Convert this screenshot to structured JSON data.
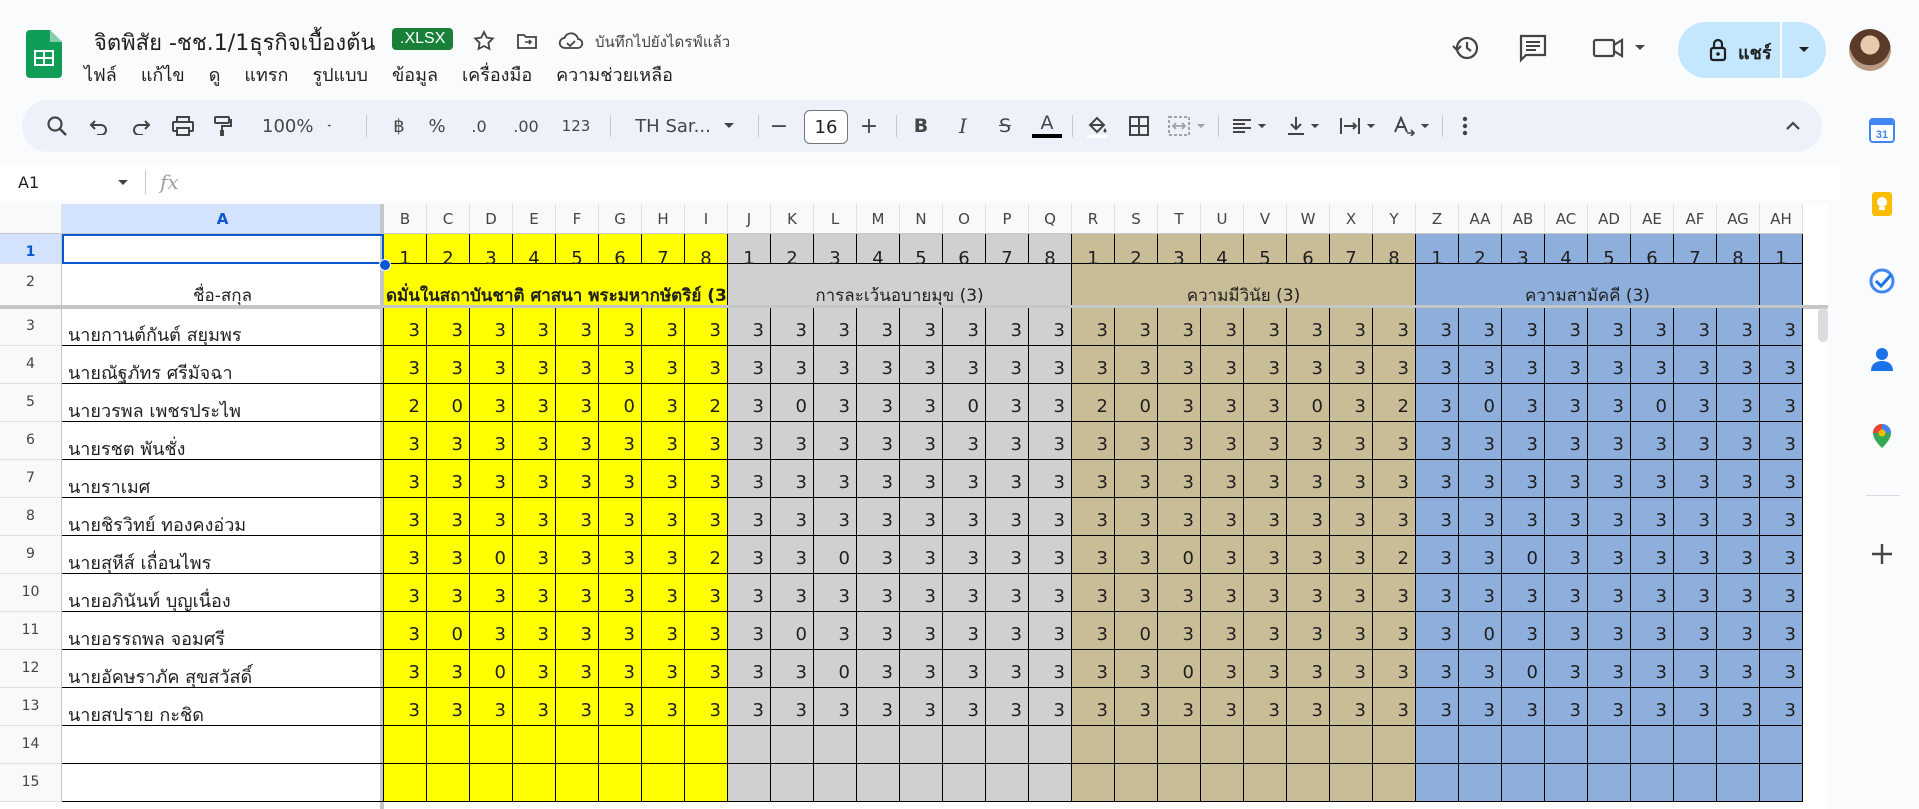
{
  "doc": {
    "title": "จิตพิสัย -ชช.1/1ธุรกิจเบื้องต้น",
    "badge": ".XLSX",
    "saved_status": "บันทึกไปยังไดรฟ์แล้ว"
  },
  "menu": [
    "ไฟล์",
    "แก้ไข",
    "ดู",
    "แทรก",
    "รูปแบบ",
    "ข้อมูล",
    "เครื่องมือ",
    "ความช่วยเหลือ"
  ],
  "share": {
    "label": "แชร์"
  },
  "toolbar": {
    "zoom": "100%",
    "currency": "฿",
    "percent": "%",
    "dec_decrease": ".0",
    "dec_increase": ".00",
    "number_format": "123",
    "font": "TH Sar...",
    "font_size": "16",
    "minus": "−",
    "plus": "+",
    "bold": "B",
    "italic": "I",
    "strike": "S",
    "text_color": "A"
  },
  "formula": {
    "cell_ref": "A1",
    "fx": "fx",
    "value": ""
  },
  "colors": {
    "yellow": "#ffff00",
    "gray": "#d0d0d0",
    "khaki": "#c8bd97",
    "blue": "#8eaedc",
    "accent": "#0b57d0",
    "sheets_green": "#0f9d58"
  },
  "columns": [
    "A",
    "B",
    "C",
    "D",
    "E",
    "F",
    "G",
    "H",
    "I",
    "J",
    "K",
    "L",
    "M",
    "N",
    "O",
    "P",
    "Q",
    "R",
    "S",
    "T",
    "U",
    "V",
    "W",
    "X",
    "Y",
    "Z",
    "AA",
    "AB",
    "AC",
    "AD",
    "AE",
    "AF",
    "AG",
    "AH"
  ],
  "row1_numbers": [
    "1",
    "2",
    "3",
    "4",
    "5",
    "6",
    "7",
    "8",
    "1",
    "2",
    "3",
    "4",
    "5",
    "6",
    "7",
    "8",
    "1",
    "2",
    "3",
    "4",
    "5",
    "6",
    "7",
    "8",
    "1",
    "2",
    "3",
    "4",
    "5",
    "6",
    "7",
    "8",
    "1"
  ],
  "row2": {
    "a2": "ชื่อ-สกุล",
    "groups": [
      "ดมั่นในสถาบันชาติ ศาสนา พระมหากษัตริย์ (3",
      "การละเว้นอบายมุข (3)",
      "ความมีวินัย (3)",
      "ความสามัคคี (3)"
    ]
  },
  "rows": [
    {
      "num": "3",
      "name": "นายกานต์กันต์  สยุมพร",
      "scores": [
        3,
        3,
        3,
        3,
        3,
        3,
        3,
        3,
        3,
        3,
        3,
        3,
        3,
        3,
        3,
        3,
        3,
        3,
        3,
        3,
        3,
        3,
        3,
        3,
        3,
        3,
        3,
        3,
        3,
        3,
        3,
        3,
        3
      ]
    },
    {
      "num": "4",
      "name": "นายณัฐภัทร  ศรีมัจฉา",
      "scores": [
        3,
        3,
        3,
        3,
        3,
        3,
        3,
        3,
        3,
        3,
        3,
        3,
        3,
        3,
        3,
        3,
        3,
        3,
        3,
        3,
        3,
        3,
        3,
        3,
        3,
        3,
        3,
        3,
        3,
        3,
        3,
        3,
        3
      ]
    },
    {
      "num": "5",
      "name": "นายวรพล  เพชรประไพ",
      "scores": [
        2,
        0,
        3,
        3,
        3,
        0,
        3,
        2,
        3,
        0,
        3,
        3,
        3,
        0,
        3,
        3,
        2,
        0,
        3,
        3,
        3,
        0,
        3,
        2,
        3,
        0,
        3,
        3,
        3,
        0,
        3,
        3,
        3
      ]
    },
    {
      "num": "6",
      "name": "นายรชต  พันชั่ง",
      "scores": [
        3,
        3,
        3,
        3,
        3,
        3,
        3,
        3,
        3,
        3,
        3,
        3,
        3,
        3,
        3,
        3,
        3,
        3,
        3,
        3,
        3,
        3,
        3,
        3,
        3,
        3,
        3,
        3,
        3,
        3,
        3,
        3,
        3
      ]
    },
    {
      "num": "7",
      "name": "นายราเมศ",
      "scores": [
        3,
        3,
        3,
        3,
        3,
        3,
        3,
        3,
        3,
        3,
        3,
        3,
        3,
        3,
        3,
        3,
        3,
        3,
        3,
        3,
        3,
        3,
        3,
        3,
        3,
        3,
        3,
        3,
        3,
        3,
        3,
        3,
        3
      ]
    },
    {
      "num": "8",
      "name": "นายชิรวิทย์  ทองคงอ่วม",
      "scores": [
        3,
        3,
        3,
        3,
        3,
        3,
        3,
        3,
        3,
        3,
        3,
        3,
        3,
        3,
        3,
        3,
        3,
        3,
        3,
        3,
        3,
        3,
        3,
        3,
        3,
        3,
        3,
        3,
        3,
        3,
        3,
        3,
        3
      ]
    },
    {
      "num": "9",
      "name": "นายสุหีส์  เถื่อนไพร",
      "scores": [
        3,
        3,
        0,
        3,
        3,
        3,
        3,
        2,
        3,
        3,
        0,
        3,
        3,
        3,
        3,
        3,
        3,
        3,
        0,
        3,
        3,
        3,
        3,
        2,
        3,
        3,
        0,
        3,
        3,
        3,
        3,
        3,
        3
      ]
    },
    {
      "num": "10",
      "name": "นายอภินันท์  บุญเนื่อง",
      "scores": [
        3,
        3,
        3,
        3,
        3,
        3,
        3,
        3,
        3,
        3,
        3,
        3,
        3,
        3,
        3,
        3,
        3,
        3,
        3,
        3,
        3,
        3,
        3,
        3,
        3,
        3,
        3,
        3,
        3,
        3,
        3,
        3,
        3
      ]
    },
    {
      "num": "11",
      "name": "นายอรรถพล  จอมศรี",
      "scores": [
        3,
        0,
        3,
        3,
        3,
        3,
        3,
        3,
        3,
        0,
        3,
        3,
        3,
        3,
        3,
        3,
        3,
        0,
        3,
        3,
        3,
        3,
        3,
        3,
        3,
        0,
        3,
        3,
        3,
        3,
        3,
        3,
        3
      ]
    },
    {
      "num": "12",
      "name": "นายอัคษราภัค  สุขสวัสดิ์",
      "scores": [
        3,
        3,
        0,
        3,
        3,
        3,
        3,
        3,
        3,
        3,
        0,
        3,
        3,
        3,
        3,
        3,
        3,
        3,
        0,
        3,
        3,
        3,
        3,
        3,
        3,
        3,
        0,
        3,
        3,
        3,
        3,
        3,
        3
      ]
    },
    {
      "num": "13",
      "name": "นายสปราย  กะชิด",
      "scores": [
        3,
        3,
        3,
        3,
        3,
        3,
        3,
        3,
        3,
        3,
        3,
        3,
        3,
        3,
        3,
        3,
        3,
        3,
        3,
        3,
        3,
        3,
        3,
        3,
        3,
        3,
        3,
        3,
        3,
        3,
        3,
        3,
        3
      ]
    },
    {
      "num": "14",
      "name": "",
      "scores": []
    },
    {
      "num": "15",
      "name": "",
      "scores": []
    }
  ],
  "row_labels": [
    "1",
    "2"
  ],
  "side_icons": [
    "calendar-icon",
    "keep-icon",
    "tasks-icon",
    "contacts-icon",
    "maps-icon",
    "add-icon"
  ]
}
